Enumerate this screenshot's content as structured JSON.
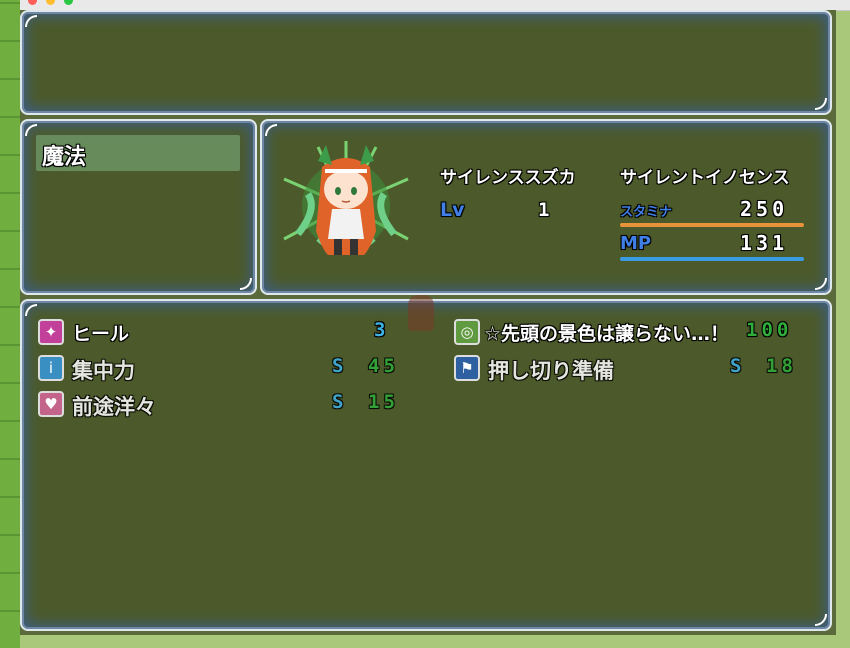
{
  "menu": {
    "selected_label": "魔法"
  },
  "actor": {
    "name": "サイレンススズカ",
    "nickname": "サイレントイノセンス",
    "level_label": "Lv",
    "level": "1",
    "stamina_label": "スタミナ",
    "stamina": "250",
    "stamina_fill": 1.0,
    "mp_label": "MP",
    "mp": "131",
    "mp_fill": 1.0
  },
  "skills": [
    {
      "icon": "heal-icon",
      "name": "ヒール",
      "cost_prefix": "",
      "cost": "3",
      "cost_color": "#3fb2e6",
      "icon_bg": "#c2409a"
    },
    {
      "icon": "target-icon",
      "name": "☆先頭の景色は譲らない…！",
      "cost_prefix": "",
      "cost": "100",
      "cost_color": "#2fae3a",
      "icon_bg": "#5f9a40"
    },
    {
      "icon": "focus-icon",
      "name": "集中力",
      "cost_prefix": "S",
      "cost": "45",
      "cost_color": "#2fae3a",
      "icon_bg": "#3a8fc2"
    },
    {
      "icon": "runner-icon",
      "name": "押し切り準備",
      "cost_prefix": "S",
      "cost": "18",
      "cost_color": "#2fae3a",
      "icon_bg": "#2e5fa0"
    },
    {
      "icon": "heart-icon",
      "name": "前途洋々",
      "cost_prefix": "S",
      "cost": "15",
      "cost_color": "#2fae3a",
      "icon_bg": "#c4648a"
    }
  ],
  "colors": {
    "stamina_bar": "#e8923a",
    "mp_bar": "#3a9be0",
    "label_blue": "#3f7fe6"
  }
}
